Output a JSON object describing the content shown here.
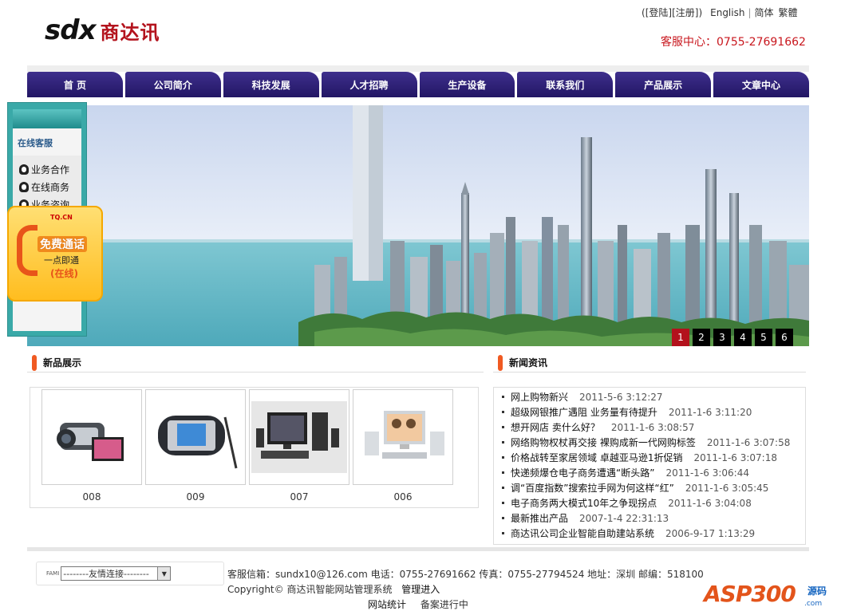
{
  "header": {
    "logo_latin": "sdx",
    "logo_cn": "商达讯",
    "login": "[登陆]",
    "register": "[注册]",
    "paren_close": ")",
    "paren_open": "(",
    "english": "English",
    "simplified": "简体",
    "traditional": "繁體",
    "hotline": "客服中心：0755-27691662"
  },
  "nav": [
    "首 页",
    "公司简介",
    "科技发展",
    "人才招聘",
    "生产设备",
    "联系我们",
    "产品展示",
    "文章中心"
  ],
  "banner": {
    "pages": [
      "1",
      "2",
      "3",
      "4",
      "5",
      "6"
    ],
    "active": 0
  },
  "service": {
    "title": "在线客服",
    "items": [
      "业务合作",
      "在线商务",
      "业务咨询"
    ],
    "call_brand": "TQ.CN",
    "call_title": "免费通话",
    "call_sub": "一点即通",
    "call_status": "(在线)"
  },
  "products": {
    "title": "新品展示",
    "items": [
      {
        "caption": "008",
        "icon": "camcorder-icon"
      },
      {
        "caption": "009",
        "icon": "pda-icon"
      },
      {
        "caption": "007",
        "icon": "desktop-pc-icon"
      },
      {
        "caption": "006",
        "icon": "family-pc-icon"
      }
    ]
  },
  "news": {
    "title": "新闻资讯",
    "items": [
      {
        "title": "网上购物新兴",
        "date": "2011-5-6 3:12:27"
      },
      {
        "title": "超级网银推广遇阻 业务量有待提升",
        "date": "2011-1-6 3:11:20"
      },
      {
        "title": "想开网店 卖什么好？",
        "date": "2011-1-6 3:08:57"
      },
      {
        "title": "网络购物权杖再交接 裸购成新一代网购标签",
        "date": "2011-1-6 3:07:58"
      },
      {
        "title": "价格战转至家居领域 卓越亚马逊1折促销",
        "date": "2011-1-6 3:07:18"
      },
      {
        "title": "快递频爆仓电子商务遭遇“断头路”",
        "date": "2011-1-6 3:06:44"
      },
      {
        "title": "调“百度指数”搜索拉手网为何这样“红”",
        "date": "2011-1-6 3:05:45"
      },
      {
        "title": "电子商务两大模式10年之争现拐点",
        "date": "2011-1-6 3:04:08"
      },
      {
        "title": "最新推出产品",
        "date": "2007-1-4 22:31:13"
      },
      {
        "title": "商达讯公司企业智能自助建站系统",
        "date": "2006-9-17 1:13:29"
      }
    ]
  },
  "footer": {
    "links_label": "FAMI",
    "links_select": "--------友情连接--------",
    "contact": "客服信箱：sundx10@126.com 电话：0755-27691662 传真：0755-27794524 地址：深圳 邮编：518100",
    "copyright": "Copyright© 商达讯智能网站管理系统",
    "admin": "管理进入",
    "stats": "网站统计",
    "icp": "备案进行中",
    "asp_logo": "ASP300",
    "asp_side": "源码",
    "asp_domain": ".com"
  },
  "colors": {
    "nav": "#2a1c74",
    "accent": "#f05a22",
    "red": "#c8161d",
    "pager_active": "#b3121c"
  }
}
